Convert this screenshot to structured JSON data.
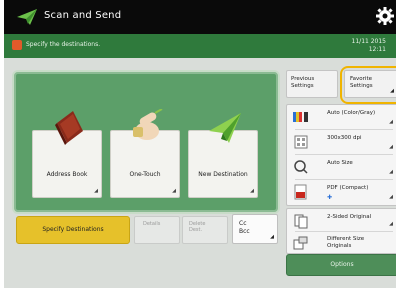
{
  "header": {
    "title": "Scan and Send",
    "logo_icon": "paper-plane-icon",
    "settings_icon": "gear-icon"
  },
  "status": {
    "message": "Specify the destinations.",
    "date": "11/11 2015",
    "time": "12:11",
    "warning_icon": "warning-icon"
  },
  "destinations": {
    "address_book": {
      "label": "Address Book",
      "icon": "address-book-icon"
    },
    "one_touch": {
      "label": "One-Touch",
      "icon": "pointing-hand-icon"
    },
    "new_destination": {
      "label": "New Destination",
      "icon": "paper-airplane-icon"
    }
  },
  "actions": {
    "specify_destinations": "Specify Destinations",
    "details": "Details",
    "delete_dest": "Delete Dest.",
    "cc_bcc": "Cc Bcc"
  },
  "right": {
    "previous_settings": "Previous Settings",
    "favorite_settings": "Favorite Settings",
    "color": "Auto (Color/Gray)",
    "resolution": "300x300 dpi",
    "size": "Auto Size",
    "format": "PDF (Compact)",
    "two_sided": "2-Sided Original",
    "different_size": "Different Size Originals",
    "options": "Options"
  },
  "colors": {
    "status_green": "#2f7a3c",
    "panel_green": "#5c9f69",
    "specify_yellow": "#e6c12a",
    "favorite_ring": "#f0b400"
  }
}
